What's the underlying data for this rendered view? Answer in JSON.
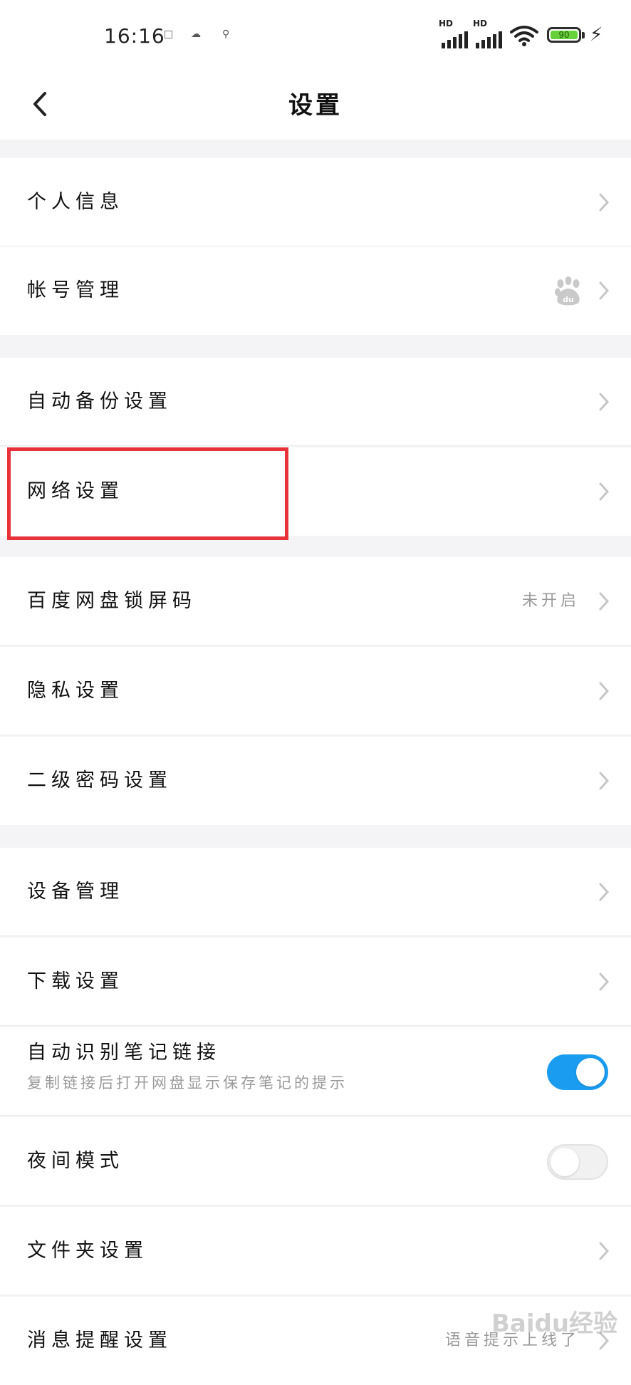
{
  "status_bar": {
    "time": "16:16",
    "signal_1_label": "HD",
    "signal_2_label": "HD",
    "battery_level": "90",
    "notification_icons": [
      "image-icon",
      "cloud-icon",
      "location-icon"
    ]
  },
  "header": {
    "title": "设置"
  },
  "rows": {
    "personal_info": "个人信息",
    "account": "帐号管理",
    "auto_backup": "自动备份设置",
    "network": "网络设置",
    "lock_code": "百度网盘锁屏码",
    "lock_code_status": "未开启",
    "privacy": "隐私设置",
    "second_password": "二级密码设置",
    "devices": "设备管理",
    "download": "下载设置",
    "note_link": "自动识别笔记链接",
    "note_link_desc": "复制链接后打开网盘显示保存笔记的提示",
    "night_mode": "夜间模式",
    "folder": "文件夹设置",
    "message": "消息提醒设置",
    "message_status": "语音提示上线了"
  },
  "toggles": {
    "note_link_on": true,
    "night_mode_on": false
  },
  "colors": {
    "accent": "#1a9df1",
    "highlight": "#e8323a",
    "battery": "#66d13a"
  },
  "watermark": "Baidu经验"
}
